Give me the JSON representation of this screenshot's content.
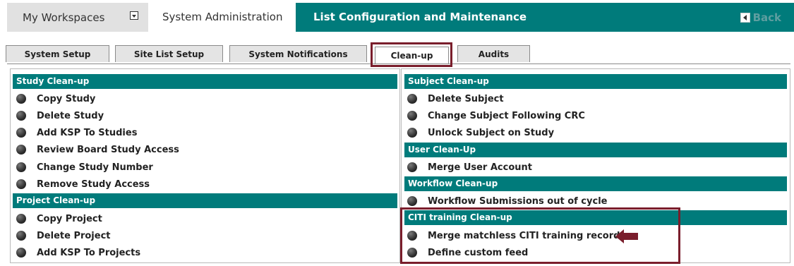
{
  "topbar": {
    "my_workspaces": "My Workspaces",
    "system_administration": "System Administration",
    "page_title": "List Configuration and Maintenance",
    "back_label": "Back"
  },
  "tabs": [
    {
      "label": "System Setup",
      "active": false
    },
    {
      "label": "Site List Setup",
      "active": false
    },
    {
      "label": "System Notifications",
      "active": false
    },
    {
      "label": "Clean-up",
      "active": true
    },
    {
      "label": "Audits",
      "active": false
    }
  ],
  "left_panel": {
    "study_header": "Study Clean-up",
    "study_items": [
      "Copy Study",
      "Delete Study",
      "Add KSP To Studies",
      "Review Board Study Access",
      "Change Study Number",
      "Remove Study Access"
    ],
    "project_header": "Project Clean-up",
    "project_items": [
      "Copy Project",
      "Delete Project",
      "Add KSP To Projects"
    ]
  },
  "right_panel": {
    "subject_header": "Subject Clean-up",
    "subject_items": [
      "Delete Subject",
      "Change Subject Following CRC",
      "Unlock Subject on Study"
    ],
    "user_header": "User Clean-Up",
    "user_items": [
      "Merge User Account"
    ],
    "workflow_header": "Workflow Clean-up",
    "workflow_items": [
      "Workflow Submissions out of cycle"
    ],
    "citi_header": "CITI training Clean-up",
    "citi_items": [
      "Merge matchless CITI training records",
      "Define custom feed"
    ]
  },
  "colors": {
    "accent_teal": "#007b7b",
    "highlight_maroon": "#7a1e2c",
    "back_text": "#5e9ea0"
  }
}
